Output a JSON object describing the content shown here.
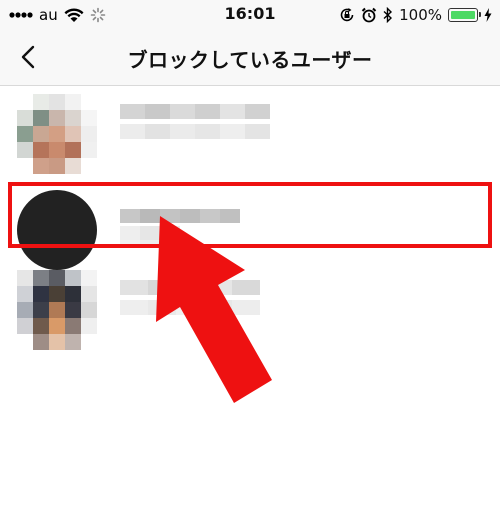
{
  "status_bar": {
    "carrier": "au",
    "time": "16:01",
    "battery_text": "100%",
    "battery_level": 1.0,
    "icons": [
      "wifi-icon",
      "loading-spinner-icon",
      "orientation-lock-icon",
      "alarm-icon",
      "bluetooth-icon",
      "battery-icon",
      "charging-icon"
    ]
  },
  "nav": {
    "back_icon": "chevron-left-icon",
    "title": "ブロックしているユーザー"
  },
  "blocked_users": [
    {
      "avatar": "pixelated-photo",
      "name": "",
      "subtitle": ""
    },
    {
      "avatar": "default-dark-circle",
      "name": "",
      "subtitle": "",
      "highlighted": true
    },
    {
      "avatar": "pixelated-photo",
      "name": "",
      "subtitle": ""
    }
  ],
  "annotation": {
    "box_color": "#ee1111",
    "arrow_color": "#ee1111"
  }
}
